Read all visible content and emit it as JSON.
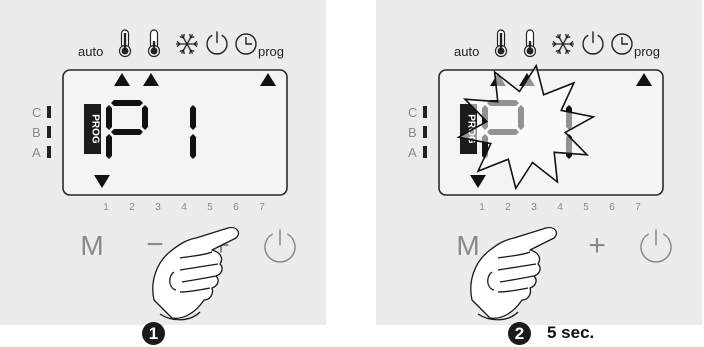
{
  "colors": {
    "panel_bg": "#ececec",
    "lcd_bg": "#f2f2f2",
    "lcd_border": "#2a2a2a",
    "ink": "#111111",
    "grey_text": "#8a8a8a"
  },
  "panels": [
    {
      "mode_labels": {
        "auto": "auto",
        "prog": "prog"
      },
      "mode_icons": [
        "thermometer-full-icon",
        "thermometer-icon",
        "snowflake-icon",
        "power-icon",
        "clock-icon"
      ],
      "zone_labels": [
        "C",
        "B",
        "A"
      ],
      "prog_tag": "PROG",
      "display_text": "P1",
      "day_numbers": [
        "1",
        "2",
        "3",
        "4",
        "5",
        "6",
        "7"
      ],
      "buttons": {
        "mode": "M",
        "minus": "−",
        "plus": "+",
        "power_icon": "power-icon"
      },
      "burst": false,
      "step": {
        "number": "1",
        "caption": ""
      }
    },
    {
      "mode_labels": {
        "auto": "auto",
        "prog": "prog"
      },
      "mode_icons": [
        "thermometer-full-icon",
        "thermometer-icon",
        "snowflake-icon",
        "power-icon",
        "clock-icon"
      ],
      "zone_labels": [
        "C",
        "B",
        "A"
      ],
      "prog_tag": "PROG",
      "display_text": "P1",
      "day_numbers": [
        "1",
        "2",
        "3",
        "4",
        "5",
        "6",
        "7"
      ],
      "buttons": {
        "mode": "M",
        "minus": "−",
        "plus": "+",
        "power_icon": "power-icon"
      },
      "burst": true,
      "step": {
        "number": "2",
        "caption": "5 sec."
      }
    }
  ]
}
